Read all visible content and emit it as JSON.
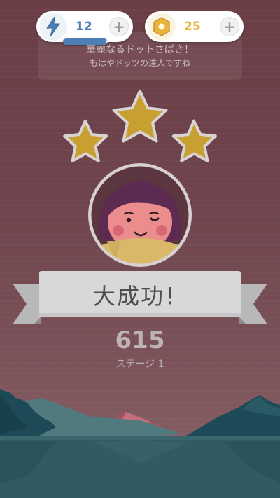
{
  "hud": {
    "energy": {
      "value": "12",
      "icon": "lightning-icon",
      "color": "#4b7fb5",
      "bar_fill_fraction": 0.95
    },
    "coins": {
      "value": "25",
      "icon": "hex-coin-icon",
      "color": "#e9b43c"
    },
    "plus_label": "+"
  },
  "message": {
    "line1": "華麗なるドットさばき！",
    "line2": "もはやドッツの達人ですね"
  },
  "result": {
    "stars_earned": 3,
    "stars_total": 3,
    "title": "大成功！",
    "score": "615",
    "stage": "ステージ 1"
  },
  "colors": {
    "background": "#6e4048",
    "star": "#c8a032",
    "ribbon": "#d8d8d8",
    "mountain_dark": "#1c4a55",
    "water": "#2f5860"
  }
}
